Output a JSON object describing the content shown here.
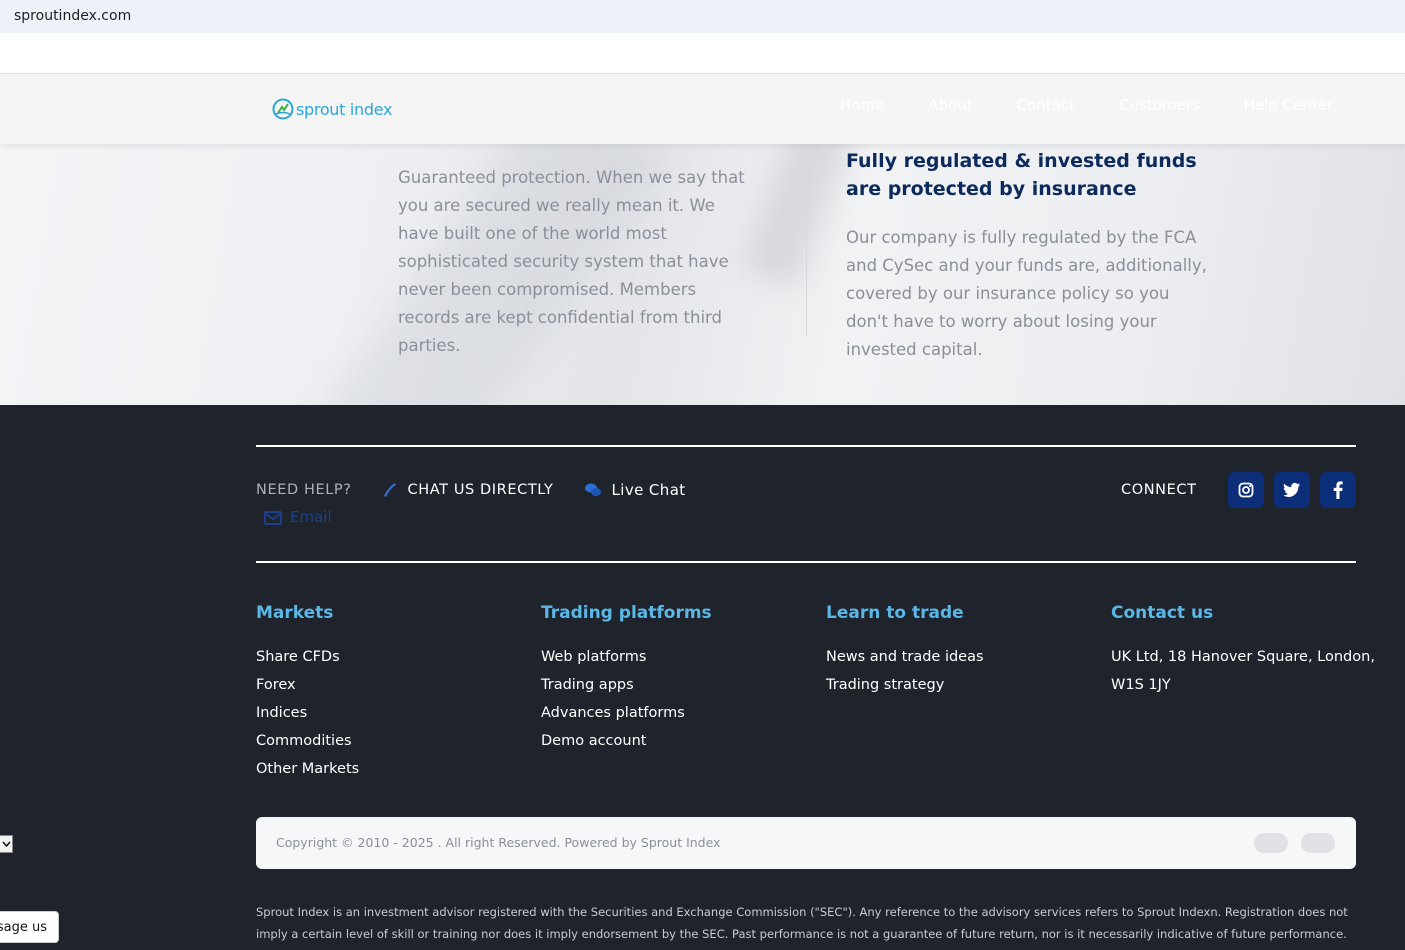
{
  "browser": {
    "url": "sproutindex.com"
  },
  "header": {
    "logo_text": "sprout index",
    "nav": [
      "Home",
      "About",
      "Contact",
      "Customers",
      "Help Center"
    ]
  },
  "features": {
    "left_text": "Guaranteed protection. When we say that you are secured we really mean it. We have built one of the world most sophisticated security system that have never been compromised. Members records are kept confidential from third parties.",
    "right_title": "Fully regulated & invested funds are protected by insurance",
    "right_text": "Our company is fully regulated by the FCA and CySec and your funds are, additionally, covered by our insurance policy so you don't have to worry about losing your invested capital."
  },
  "footer": {
    "need_help": "NEED HELP?",
    "chat_directly": "CHAT US DIRECTLY",
    "live_chat": "Live Chat",
    "email": "Email",
    "connect": "CONNECT",
    "social": [
      "instagram-icon",
      "twitter-icon",
      "facebook-icon"
    ],
    "columns": [
      {
        "title": "Markets",
        "items": [
          "Share CFDs",
          "Forex",
          "Indices",
          "Commodities",
          "Other Markets"
        ]
      },
      {
        "title": "Trading platforms",
        "items": [
          "Web platforms",
          "Trading apps",
          "Advances platforms",
          "Demo account"
        ]
      },
      {
        "title": "Learn to trade",
        "items": [
          "News and trade ideas",
          "Trading strategy"
        ]
      },
      {
        "title": "Contact us",
        "items": [
          "UK Ltd, 18 Hanover Square, London,",
          "W1S 1JY"
        ]
      }
    ],
    "copyright": "Copyright © 2010 - 2025 . All right Reserved. Powered by Sprout Index",
    "disclaimer": "Sprout Index is an investment advisor registered with the Securities and Exchange Commission (\"SEC\"). Any reference to the advisory services refers to Sprout Indexn. Registration does not imply a certain level of skill or training nor does it imply endorsement by the SEC. Past performance is not a guarantee of future return, nor is it necessarily indicative of future performance."
  },
  "widget": {
    "message_label": "Message us"
  },
  "colors": {
    "accent": "#5ab7e6",
    "navy": "#0d2a5c",
    "social_bg": "#0c2d78",
    "footer_bg": "#1f232b"
  }
}
